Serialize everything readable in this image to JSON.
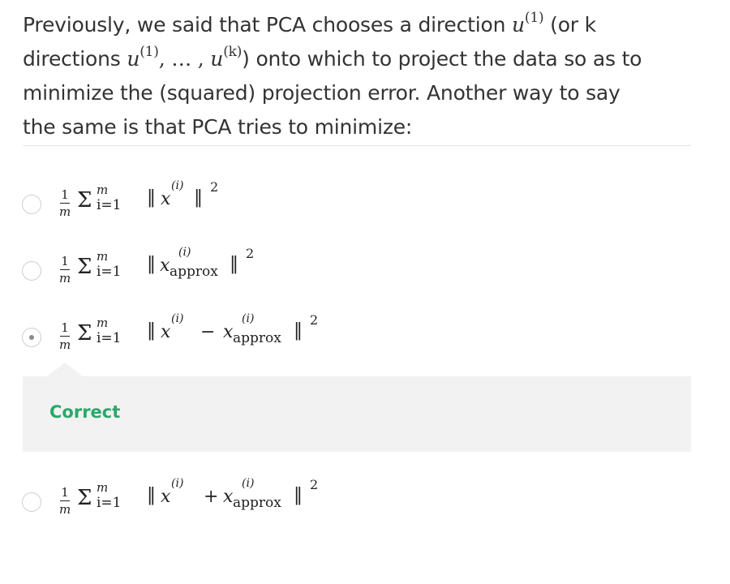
{
  "question": {
    "seg1": "Previously, we said that PCA chooses a direction ",
    "u": "u",
    "sup1": "(1)",
    "seg2": " (or k",
    "seg3": "directions ",
    "seq_u1": "u",
    "seq_sup1": "(1)",
    "seq_mid": ", … , ",
    "seq_u2": "u",
    "seq_supk": "(k)",
    "seg4": ") onto which to project the data so as to",
    "seg5": "minimize the (squared) projection error. Another way to say",
    "seg6": "the same is that PCA tries to minimize:"
  },
  "options": [
    {
      "checked": false,
      "formula": {
        "num": "1",
        "den": "m",
        "sigma": "Σ",
        "upper": "m",
        "lower": "i=1",
        "norm_open": "‖",
        "x": "x",
        "x_sup": "(i)",
        "norm_close": "‖",
        "power": "2"
      }
    },
    {
      "checked": false,
      "formula": {
        "num": "1",
        "den": "m",
        "sigma": "Σ",
        "upper": "m",
        "lower": "i=1",
        "norm_open": "‖",
        "x": "x",
        "x_sup": "(i)",
        "sub": "approx",
        "norm_close": "‖",
        "power": "2"
      }
    },
    {
      "checked": true,
      "formula": {
        "num": "1",
        "den": "m",
        "sigma": "Σ",
        "upper": "m",
        "lower": "i=1",
        "norm_open": "‖",
        "x": "x",
        "x_sup": "(i)",
        "op": "−",
        "x2": "x",
        "x2_sup": "(i)",
        "sub": "approx",
        "norm_close": "‖",
        "power": "2"
      }
    },
    {
      "checked": false,
      "formula": {
        "num": "1",
        "den": "m",
        "sigma": "Σ",
        "upper": "m",
        "lower": "i=1",
        "norm_open": "‖",
        "x": "x",
        "x_sup": "(i)",
        "op": "+",
        "x2": "x",
        "x2_sup": "(i)",
        "sub": "approx",
        "norm_close": "‖",
        "power": "2"
      }
    }
  ],
  "feedback": {
    "label": "Correct",
    "label_color": "#2aa86a"
  }
}
